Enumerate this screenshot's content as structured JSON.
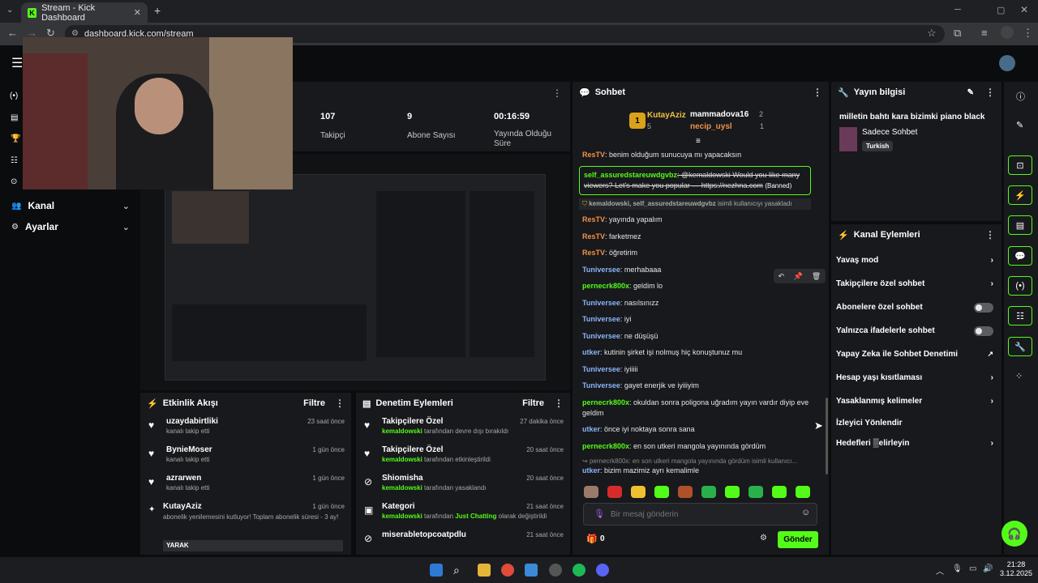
{
  "browser": {
    "tab_title": "Stream - Kick Dashboard",
    "tab_icon": "K",
    "url": "dashboard.kick.com/stream"
  },
  "sidebar": {
    "items": [
      {
        "label": "Kanal"
      },
      {
        "label": "Ayarlar"
      }
    ]
  },
  "stats": [
    {
      "value": "107",
      "label": "Takipçi"
    },
    {
      "value": "9",
      "label": "Abone Sayısı"
    },
    {
      "value": "00:16:59",
      "label": "Yayında Olduğu Süre"
    }
  ],
  "chat": {
    "title": "Sohbet",
    "leaders": {
      "first_name": "KutayAziz",
      "first_count": "5",
      "first_rank": "1",
      "second_name": "mammadova16",
      "second_count": "2",
      "third_name": "necip_uysl",
      "third_count": "1"
    },
    "messages": [
      {
        "user": "ResTV",
        "color": "orange",
        "text": ": benim olduğum sunucuya mı yapacaksın"
      },
      {
        "user": "ResTV",
        "color": "orange",
        "text": ": yayında yapalım"
      },
      {
        "user": "ResTV",
        "color": "orange",
        "text": ": farketmez"
      },
      {
        "user": "ResTV",
        "color": "orange",
        "text": ": öğretirim"
      },
      {
        "user": "Tuniversee",
        "color": "blue",
        "text": ": merhabaaa"
      },
      {
        "user": "pernecrk800x",
        "color": "green",
        "text": ": geldim lo"
      },
      {
        "user": "Tuniversee",
        "color": "blue",
        "text": ": nasılsınızz"
      },
      {
        "user": "Tuniversee",
        "color": "blue",
        "text": ": iyi"
      },
      {
        "user": "Tuniversee",
        "color": "blue",
        "text": ": ne düşüşü"
      },
      {
        "user": "utker",
        "color": "blue",
        "text": ": kutinin şirket işi nolmuş hiç konuştunuz mu"
      },
      {
        "user": "Tuniversee",
        "color": "blue",
        "text": ": iyiiiii"
      },
      {
        "user": "Tuniversee",
        "color": "blue",
        "text": ": gayet enerjik ve iyiiiyim"
      },
      {
        "user": "pernecrk800x",
        "color": "green",
        "text": ": okuldan sonra poligona uğradım yayın vardır diyip eve geldim"
      },
      {
        "user": "utker",
        "color": "blue",
        "text": ": önce iyi noktaya sonra sana"
      },
      {
        "user": "pernecrk800x",
        "color": "green",
        "text": ": en son utkeri mangola yayınında gördüm"
      }
    ],
    "banned_msg": {
      "user": "self_assuredstareuwdgvbz",
      "text": ": @kemaldowski Would you like many viewers? Let's make you popular — https://nezhna.com",
      "tag": "(Banned)"
    },
    "ban_notice": {
      "users": "kemaldowski, self_assuredstareuwdgvbz",
      "text": "isimli kullanıcıyı yasakladı"
    },
    "reply_context": "pernecrk800x: en son utkeri mangola yayınında gördüm isimli kullanıcı...",
    "last_msg": {
      "user": "utker",
      "text": ": bizim mazimiz ayrı kemalimle"
    },
    "input_placeholder": "Bir mesaj gönderin",
    "points": "0",
    "send_label": "Gönder"
  },
  "stream_info": {
    "title": "Yayın bilgisi",
    "stream_title": "milletin bahtı kara bizimki piano black",
    "category": "Sadece Sohbet",
    "tag": "Turkish"
  },
  "channel_actions": {
    "title": "Kanal Eylemleri",
    "items": [
      {
        "label": "Yavaş mod",
        "control": "chevron"
      },
      {
        "label": "Takipçilere özel sohbet",
        "control": "chevron"
      },
      {
        "label": "Abonelere özel sohbet",
        "control": "toggle"
      },
      {
        "label": "Yalnızca ifadelerle sohbet",
        "control": "toggle"
      },
      {
        "label": "Yapay Zeka ile Sohbet Denetimi",
        "control": "external"
      },
      {
        "label": "Hesap yaşı kısıtlaması",
        "control": "chevron"
      },
      {
        "label": "Yasaklanmış kelimeler",
        "control": "chevron"
      },
      {
        "label": "İzleyici Yönlendir",
        "control": "none"
      },
      {
        "label": "Hedefleri ▒elirleyin",
        "control": "chevron"
      }
    ]
  },
  "activity_feed": {
    "title": "Etkinlik Akışı",
    "filter": "Filtre",
    "items": [
      {
        "name": "uzaydabirtliki",
        "sub": "kanalı takip etti",
        "time": "23 saat önce"
      },
      {
        "name": "BynieMoser",
        "sub": "kanalı takip etti",
        "time": "1 gün önce"
      },
      {
        "name": "azrarwen",
        "sub": "kanalı takip etti",
        "time": "1 gün önce"
      },
      {
        "name": "KutayAziz",
        "sub": "abonelik yenilemesini kutluyor! Toplam abonelik süresi - 3 ay!",
        "time": "1 gün önce"
      }
    ],
    "yarak": "YARAK"
  },
  "mod_actions": {
    "title": "Denetim Eylemleri",
    "filter": "Filtre",
    "items": [
      {
        "name": "Takipçilere Özel",
        "actor": "kemaldowski",
        "sub": " tarafından devre dışı bırakıldı",
        "time": "27 dakika önce"
      },
      {
        "name": "Takipçilere Özel",
        "actor": "kemaldowski",
        "sub": " tarafından etkinleştirildi",
        "time": "20 saat önce"
      },
      {
        "name": "Shiomisha",
        "actor": "kemaldowski",
        "sub": " tarafından yasaklandı",
        "time": "20 saat önce"
      },
      {
        "name": "Kategori",
        "actor": "kemaldowski",
        "sub": " tarafından ",
        "extra": "Just Chatting",
        "sub2": " olarak değiştirildi",
        "time": "21 saat önce"
      },
      {
        "name": "miserabletopcoatpdlu",
        "actor": "",
        "sub": "",
        "time": "21 saat önce"
      }
    ]
  },
  "taskbar": {
    "time": "21:28",
    "date": "3.12.2025"
  },
  "colors": {
    "accent": "#53fc18",
    "panel": "#18191c",
    "bg": "#0b0c0e"
  }
}
